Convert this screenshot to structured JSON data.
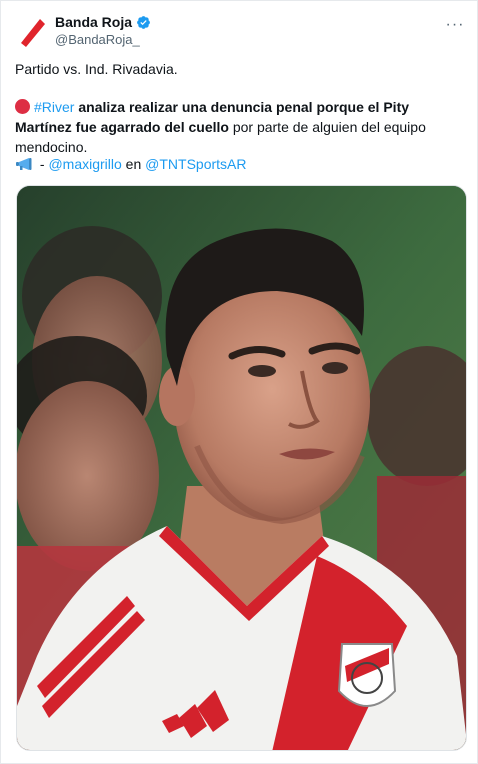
{
  "tweet": {
    "display_name": "Banda Roja",
    "handle": "@BandaRoja_",
    "more_label": "···",
    "line1": "Partido vs. Ind. Rivadavia.",
    "line2": {
      "hashtag": "#River",
      "bold_part": " analiza realizar una denuncia penal porque el Pity Martínez fue agarrado del cuello",
      "regular_part": " por parte de alguien del equipo mendocino."
    },
    "line3": {
      "prefix": " - ",
      "mention1": "@maxigrillo",
      "middle": " en ",
      "mention2": "@TNTSportsAR"
    },
    "icons": {
      "avatar": "red-slash-logo",
      "verified": "verified-badge-icon",
      "more": "more-options-icon",
      "circle": "red-circle-emoji",
      "megaphone": "megaphone-emoji"
    },
    "media": {
      "description_hidden": "",
      "crest_text": "CARP"
    },
    "colors": {
      "link": "#1d9bf0",
      "verified": "#1d9bf0",
      "red": "#dd2e44",
      "river_red": "#d3222c"
    }
  }
}
